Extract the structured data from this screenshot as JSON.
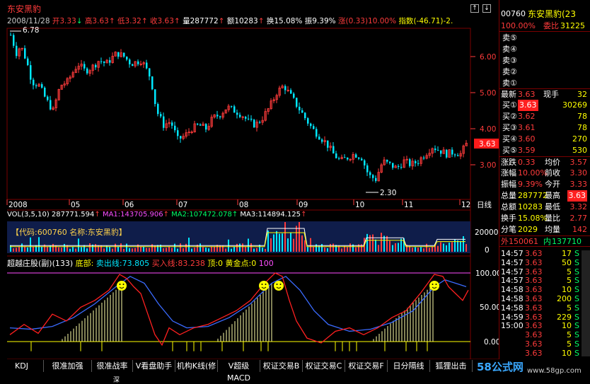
{
  "stock": {
    "code": "00760",
    "name": "东安黑豹",
    "name_cut": "东安黑豹(23"
  },
  "header": {
    "date": "2008/11/28",
    "open_label": "开",
    "open": "3.33",
    "high_label": "高",
    "high": "3.63",
    "low_label": "低",
    "low": "3.32",
    "close_label": "收",
    "close": "3.63",
    "vol_label": "量",
    "vol": "287772",
    "amt_label": "额",
    "amt": "10283",
    "turn_label": "换",
    "turn": "15.08%",
    "amp_label": "振",
    "amp": "9.39%",
    "chg_label": "涨",
    "chg": "(0.33)",
    "chg_pct": "10.00%",
    "index_label": "指数",
    "index": "(-46.71)-2."
  },
  "price_chart": {
    "annotations": {
      "max": "6.78",
      "min": "2.30",
      "last": "3.63"
    },
    "y_ticks": [
      "6.00",
      "5.00",
      "4.00",
      "3.00"
    ],
    "x_ticks": [
      "2008",
      "05",
      "06",
      "07",
      "08",
      "09",
      "10",
      "11",
      "12"
    ],
    "period_label": "日线"
  },
  "volume": {
    "title": "VOL(3,5,10)",
    "vol": "287771.594",
    "ma1_label": "MA1:",
    "ma1": "143705.906",
    "ma2_label": "MA2:",
    "ma2": "107472.078",
    "ma3_label": "MA3:",
    "ma3": "114894.125",
    "overlay_code": "【代码:600760 名称:东安黑豹】",
    "y_ticks": [
      "200000",
      "0"
    ]
  },
  "indicator": {
    "title": "超越庄股(副)(133)",
    "bottom_label": "底部:",
    "sell_label": "卖出线:",
    "sell": "73.805",
    "buy_label": "买入线:",
    "buy": "83.238",
    "top_label": "顶:",
    "top_val": "0",
    "gold_label": "黄金点:",
    "gold": "0",
    "gold2": "100",
    "y_ticks": [
      "100.00",
      "50.00",
      "0.00"
    ]
  },
  "quote": {
    "ratio_label": "委比",
    "ratio": "100.00%",
    "ratio_val": "31225",
    "sell": [
      {
        "label": "卖⑤",
        "price": "",
        "vol": ""
      },
      {
        "label": "卖④",
        "price": "",
        "vol": ""
      },
      {
        "label": "卖③",
        "price": "",
        "vol": ""
      },
      {
        "label": "卖②",
        "price": "",
        "vol": ""
      },
      {
        "label": "卖①",
        "price": "",
        "vol": ""
      }
    ],
    "last_label": "最新",
    "last": "3.63",
    "hand_label": "现手",
    "hand": "32",
    "buy": [
      {
        "label": "买①",
        "price": "3.63",
        "vol": "30269"
      },
      {
        "label": "买②",
        "price": "3.62",
        "vol": "78"
      },
      {
        "label": "买③",
        "price": "3.61",
        "vol": "78"
      },
      {
        "label": "买④",
        "price": "3.60",
        "vol": "270"
      },
      {
        "label": "买⑤",
        "price": "3.59",
        "vol": "530"
      }
    ],
    "stats": [
      {
        "l1": "涨跌",
        "v1": "0.33",
        "l2": "均价",
        "v2": "3.57"
      },
      {
        "l1": "涨幅",
        "v1": "10.00%",
        "l2": "前收",
        "v2": "3.30"
      },
      {
        "l1": "振幅",
        "v1": "9.39%",
        "l2": "今开",
        "v2": "3.33"
      },
      {
        "l1": "总量",
        "v1": "287772",
        "l2": "最高",
        "v2": "3.63"
      },
      {
        "l1": "总额",
        "v1": "10283",
        "l2": "最低",
        "v2": "3.32"
      },
      {
        "l1": "换手",
        "v1": "15.08%",
        "l2": "量比",
        "v2": "2.77"
      },
      {
        "l1": "分笔",
        "v1": "2029",
        "l2": "均量",
        "v2": "142"
      }
    ],
    "outer_label": "外",
    "outer": "150061",
    "inner_label": "内",
    "inner": "137710"
  },
  "ticks": [
    {
      "t": "14:57",
      "p": "3.63",
      "v": "17",
      "s": "S"
    },
    {
      "t": "14:57",
      "p": "3.63",
      "v": "50",
      "s": "S"
    },
    {
      "t": "14:57",
      "p": "3.63",
      "v": "5",
      "s": "S"
    },
    {
      "t": "14:57",
      "p": "3.63",
      "v": "5",
      "s": "S"
    },
    {
      "t": "14:58",
      "p": "3.63",
      "v": "10",
      "s": "S"
    },
    {
      "t": "14:58",
      "p": "3.63",
      "v": "200",
      "s": "S"
    },
    {
      "t": "14:58",
      "p": "3.63",
      "v": "5",
      "s": "S"
    },
    {
      "t": "14:59",
      "p": "3.63",
      "v": "229",
      "s": "S"
    },
    {
      "t": "15:00",
      "p": "3.63",
      "v": "10",
      "s": "S"
    },
    {
      "t": "",
      "p": "3.63",
      "v": "5",
      "s": "S"
    },
    {
      "t": "",
      "p": "3.63",
      "v": "5",
      "s": "S"
    },
    {
      "t": "",
      "p": "3.63",
      "v": "10",
      "s": "S"
    }
  ],
  "tabs": [
    "KDJ",
    "很准加强",
    "很准战率",
    "V看盘助手",
    "机构K线(修",
    "V超级MACD",
    "权证交易B",
    "权证交易C",
    "权证交易F",
    "日分隔线",
    "狐狸出击"
  ],
  "watermark": {
    "text": "58公式网",
    "url": "www.58gp.com"
  },
  "status_partial": "深",
  "colors": {
    "up": "#ff3b3b",
    "down": "#00e8ff",
    "yellow": "#ffff00",
    "magenta": "#ff4dff",
    "green": "#00ff66"
  }
}
